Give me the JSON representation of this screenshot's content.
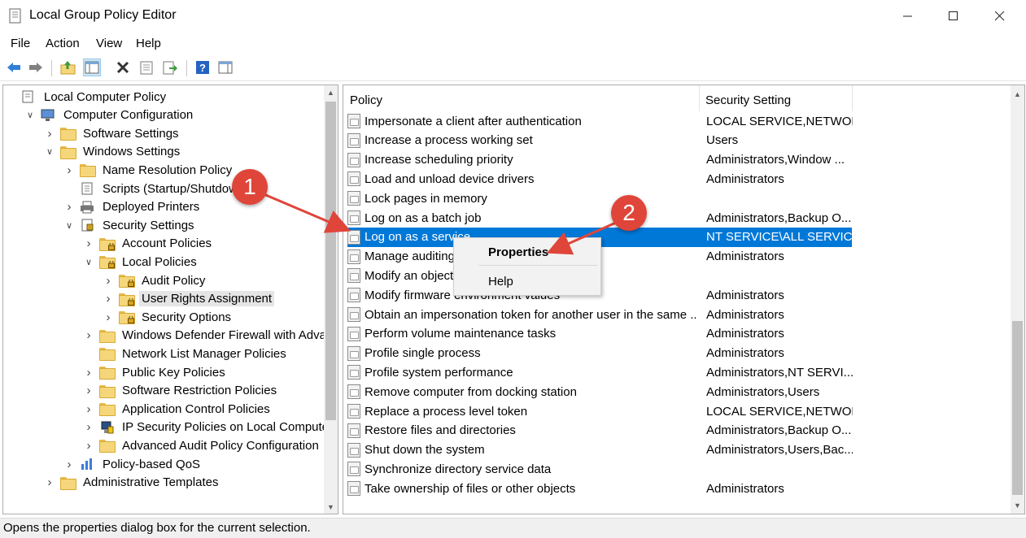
{
  "window": {
    "title": "Local Group Policy Editor",
    "controls": {
      "minimize": "—",
      "maximize": "☐",
      "close": "✕"
    }
  },
  "menu": [
    "File",
    "Action",
    "View",
    "Help"
  ],
  "toolbar": [
    "back-icon",
    "forward-icon",
    "up-folder-icon",
    "show-hide-tree-icon",
    "delete-icon",
    "properties-icon",
    "export-list-icon",
    "help-icon",
    "action-pane-icon"
  ],
  "tree": [
    {
      "label": "Local Computer Policy",
      "icon": "computer-policy-icon"
    },
    {
      "label": "Computer Configuration",
      "icon": "computer-icon",
      "expander": "∨"
    },
    {
      "label": "Software Settings",
      "icon": "folder-icon",
      "expander": "›"
    },
    {
      "label": "Windows Settings",
      "icon": "folder-icon",
      "expander": "∨"
    },
    {
      "label": "Name Resolution Policy",
      "icon": "folder-icon",
      "expander": "›"
    },
    {
      "label": "Scripts (Startup/Shutdown)",
      "icon": "script-icon"
    },
    {
      "label": "Deployed Printers",
      "icon": "printer-icon",
      "expander": "›"
    },
    {
      "label": "Security Settings",
      "icon": "security-icon",
      "expander": "∨"
    },
    {
      "label": "Account Policies",
      "icon": "folder-lock-icon",
      "expander": "›"
    },
    {
      "label": "Local Policies",
      "icon": "folder-lock-icon",
      "expander": "∨"
    },
    {
      "label": "Audit Policy",
      "icon": "folder-lock-icon",
      "expander": "›"
    },
    {
      "label": "User Rights Assignment",
      "icon": "folder-lock-icon",
      "expander": "›"
    },
    {
      "label": "Security Options",
      "icon": "folder-lock-icon",
      "expander": "›"
    },
    {
      "label": "Windows Defender Firewall with Advance",
      "icon": "folder-icon",
      "expander": "›"
    },
    {
      "label": "Network List Manager Policies",
      "icon": "folder-icon"
    },
    {
      "label": "Public Key Policies",
      "icon": "folder-icon",
      "expander": "›"
    },
    {
      "label": "Software Restriction Policies",
      "icon": "folder-icon",
      "expander": "›"
    },
    {
      "label": "Application Control Policies",
      "icon": "folder-icon",
      "expander": "›"
    },
    {
      "label": "IP Security Policies on Local Computer",
      "icon": "ipsec-icon",
      "expander": "›"
    },
    {
      "label": "Advanced Audit Policy Configuration",
      "icon": "folder-icon",
      "expander": "›"
    },
    {
      "label": "Policy-based QoS",
      "icon": "qos-icon",
      "expander": "›"
    },
    {
      "label": "Administrative Templates",
      "icon": "folder-icon",
      "expander": "›"
    }
  ],
  "columns": {
    "policy": "Policy",
    "setting": "Security Setting"
  },
  "policies": [
    {
      "name": "Impersonate a client after authentication",
      "setting": "LOCAL SERVICE,NETWOR..."
    },
    {
      "name": "Increase a process working set",
      "setting": "Users"
    },
    {
      "name": "Increase scheduling priority",
      "setting": "Administrators,Window ..."
    },
    {
      "name": "Load and unload device drivers",
      "setting": "Administrators"
    },
    {
      "name": "Lock pages in memory",
      "setting": ""
    },
    {
      "name": "Log on as a batch job",
      "setting": "Administrators,Backup O..."
    },
    {
      "name": "Log on as a service",
      "setting": "NT SERVICE\\ALL SERVICE..."
    },
    {
      "name": "Manage auditing and security log",
      "setting": "Administrators"
    },
    {
      "name": "Modify an object label",
      "setting": ""
    },
    {
      "name": "Modify firmware environment values",
      "setting": "Administrators"
    },
    {
      "name": "Obtain an impersonation token for another user in the same ...",
      "setting": "Administrators"
    },
    {
      "name": "Perform volume maintenance tasks",
      "setting": "Administrators"
    },
    {
      "name": "Profile single process",
      "setting": "Administrators"
    },
    {
      "name": "Profile system performance",
      "setting": "Administrators,NT SERVI..."
    },
    {
      "name": "Remove computer from docking station",
      "setting": "Administrators,Users"
    },
    {
      "name": "Replace a process level token",
      "setting": "LOCAL SERVICE,NETWOR..."
    },
    {
      "name": "Restore files and directories",
      "setting": "Administrators,Backup O..."
    },
    {
      "name": "Shut down the system",
      "setting": "Administrators,Users,Bac..."
    },
    {
      "name": "Synchronize directory service data",
      "setting": ""
    },
    {
      "name": "Take ownership of files or other objects",
      "setting": "Administrators"
    }
  ],
  "context_menu": {
    "properties": "Properties",
    "help": "Help"
  },
  "annotations": {
    "badge1": "1",
    "badge2": "2",
    "color": "#e0453a"
  },
  "status": "Opens the properties dialog box for the current selection.",
  "colors": {
    "selection": "#0078d7",
    "tree_selection": "#e5e5e5"
  }
}
